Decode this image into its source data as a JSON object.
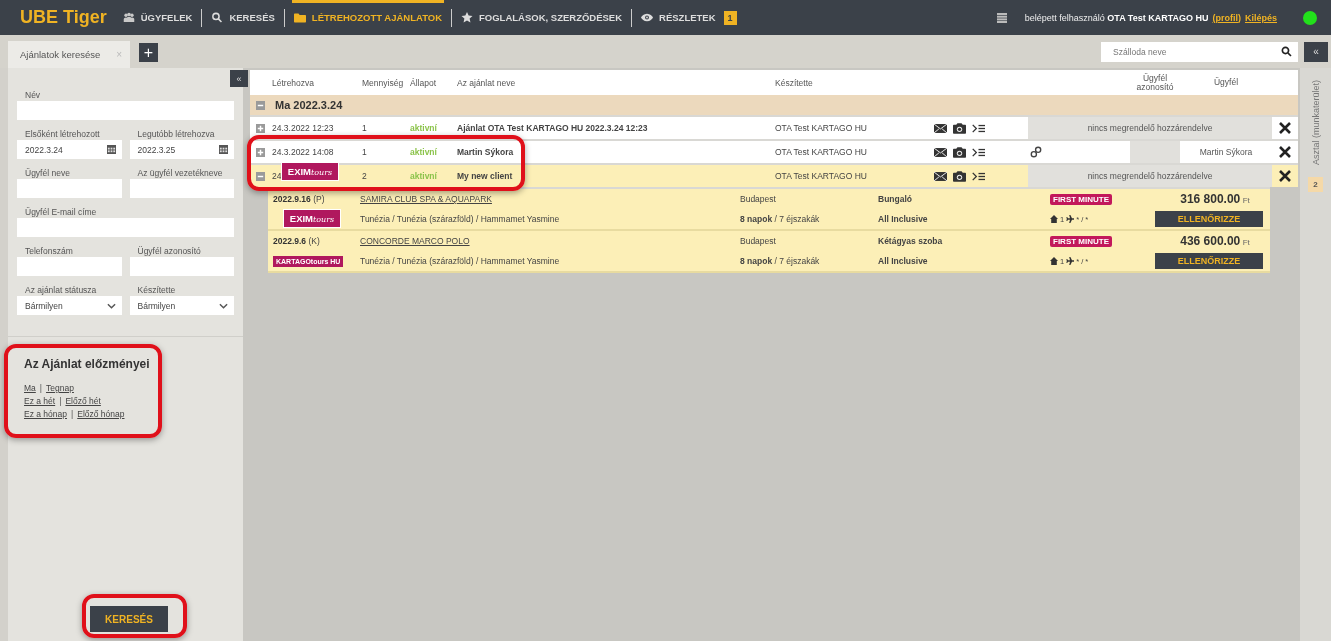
{
  "nav": {
    "logo": "UBE Tiger",
    "items": [
      {
        "label": "ÜGYFELEK",
        "selected": false
      },
      {
        "label": "KERESÉS",
        "selected": false
      },
      {
        "label": "LÉTREHOZOTT AJÁNLATOK",
        "selected": true
      },
      {
        "label": "FOGLALÁSOK, SZERZŐDÉSEK",
        "selected": false
      },
      {
        "label": "RÉSZLETEK",
        "selected": false,
        "badge": "1"
      }
    ],
    "user": {
      "text": "belépett felhasználó **OTA Test KARTAGO HU**",
      "profile_link": "(profil)",
      "logout_link": "Kilépés"
    },
    "online": true
  },
  "tabs": [
    {
      "label": "Ajánlatok keresése",
      "close": "×",
      "selected": true
    }
  ],
  "add_tab": "+",
  "hotel_search": {
    "placeholder": "Szálloda neve"
  },
  "filter": {
    "collapse": "«",
    "rows": [
      [
        {
          "label": "Név",
          "kind": "text"
        }
      ],
      [
        {
          "label": "Elsőként létrehozott",
          "kind": "date",
          "value": "2022.3.24"
        },
        {
          "label": "Legutóbb létrehozva",
          "kind": "date",
          "value": "2022.3.25"
        }
      ],
      [
        {
          "label": "Ügyfél neve",
          "kind": "text"
        },
        {
          "label": "Az ügyfél vezetékneve",
          "kind": "text"
        }
      ],
      [
        {
          "label": "Ügyfél E-mail címe",
          "kind": "text"
        }
      ],
      [
        {
          "label": "Telefonszám",
          "kind": "text"
        },
        {
          "label": "Ügyfél azonosító",
          "kind": "text"
        }
      ],
      [
        {
          "label": "Az ajánlat státusza",
          "kind": "select",
          "value": "Bármilyen"
        },
        {
          "label": "Készítette",
          "kind": "select",
          "value": "Bármilyen"
        }
      ]
    ],
    "history": {
      "title": "Az Ajánlat előzményei",
      "separator": "|",
      "links": [
        [
          "Ma",
          "Tegnap"
        ],
        [
          "Ez a hét",
          "Előző hét"
        ],
        [
          "Ez a hónap",
          "Előző hónap"
        ]
      ]
    },
    "search_button": "KERESÉS"
  },
  "table": {
    "columns": [
      "Létrehozva",
      "Mennyiség",
      "Állapot",
      "Az ajánlat neve",
      "Készítette",
      "Ügyfél azonosító",
      "Ügyfél"
    ],
    "groups": [
      {
        "label": "Ma 2022.3.24",
        "expanded": true,
        "rows": [
          {
            "created": "24.3.2022 12:23",
            "quantity": "1",
            "status": "aktivní",
            "name": "Ajánlat OTA Test KARTAGO HU 2022.3.24 12:23",
            "author": "OTA Test KARTAGO HU",
            "expanded": false,
            "client_note": "nincs megrendelő hozzárendelve"
          },
          {
            "created": "24.3.2022 14:08",
            "quantity": "1",
            "status": "aktivní",
            "name": "Martin Sýkora",
            "author": "OTA Test KARTAGO HU",
            "expanded": false,
            "client": "Martin Sýkora"
          },
          {
            "created": "24",
            "quantity": "2",
            "status": "aktivní",
            "name": "My new client",
            "author": "OTA Test KARTAGO HU",
            "expanded": true,
            "client_note": "nincs megrendelő hozzárendelve",
            "hotels": [
              {
                "date": "2022.9.16",
                "day": "(P)",
                "name": "SAMIRA CLUB SPA & AQUAPARK",
                "city": "Budapest",
                "room": "Bungaló",
                "destination": "Tunézia / Tunézia (szárazföld) / Hammamet Yasmine",
                "duration": "**8 napok** / 7 éjszakák",
                "board": "All Inclusive",
                "badge": "FIRST MINUTE",
                "rooms": "1",
                "pax": "* / *",
                "price": "316 800.00",
                "currency": "Ft",
                "button": "ELLENŐRIZZE"
              },
              {
                "date": "2022.9.6",
                "day": "(K)",
                "name": "CONCORDE MARCO POLO",
                "city": "Budapest",
                "room": "Kétágyas szoba",
                "destination": "Tunézia / Tunézia (szárazföld) / Hammamet Yasmine",
                "duration": "**8 napok** / 7 éjszakák",
                "board": "All Inclusive",
                "badge": "FIRST MINUTE",
                "rooms": "1",
                "pax": "* / *",
                "price": "436 600.00",
                "currency": "Ft",
                "button": "ELLENŐRIZZE",
                "logo": "KARTAGOtours HU"
              }
            ]
          }
        ]
      }
    ]
  },
  "stickers": [
    {
      "brand": "EXIM",
      "tagline": "tours"
    },
    {
      "brand": "EXIM",
      "tagline": "tours"
    }
  ],
  "desk": {
    "collapse": "«",
    "label": "Asztal (munkaterület)",
    "count": "2"
  }
}
